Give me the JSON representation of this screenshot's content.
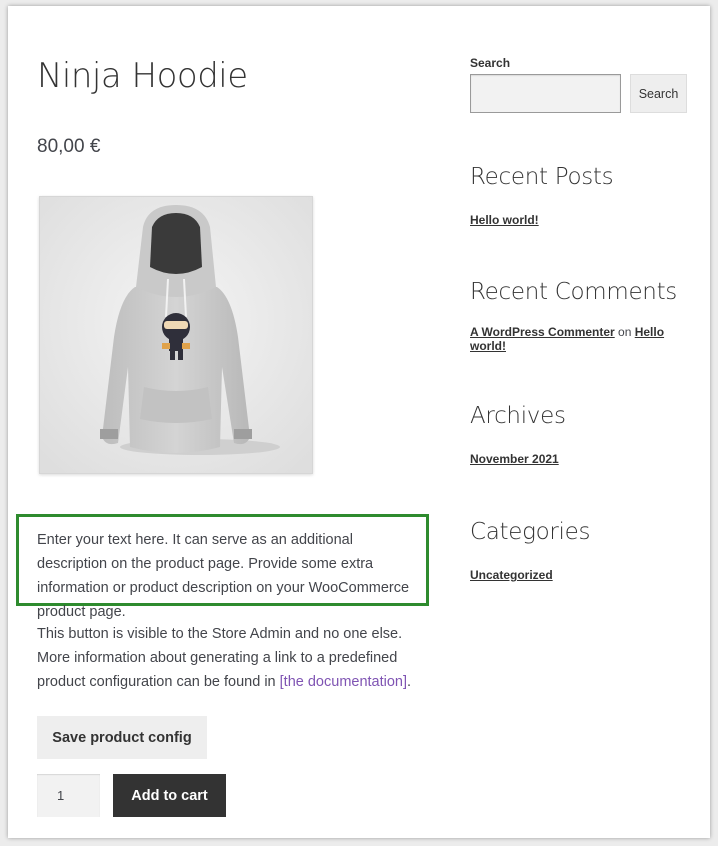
{
  "product": {
    "title": "Ninja Hoodie",
    "price": "80,00 €",
    "image_alt": "hoodie-product-image",
    "custom_text": "Enter your text here. It can serve as an additional description on the product page. Provide some extra information or product description on your WooCommerce product page.",
    "admin_note": {
      "before": "This button is visible to the Store Admin and no one else. More information about generating a link to a predefined product configuration can be found in ",
      "link": "[the documentation]",
      "after": "."
    },
    "save_config_label": "Save product config",
    "quantity": "1",
    "add_to_cart_label": "Add to cart"
  },
  "sidebar": {
    "search": {
      "label": "Search",
      "button_label": "Search",
      "value": ""
    },
    "recent_posts": {
      "title": "Recent Posts",
      "items": [
        "Hello world!"
      ]
    },
    "recent_comments": {
      "title": "Recent Comments",
      "author": "A WordPress Commenter",
      "connector": " on ",
      "post": "Hello world!"
    },
    "archives": {
      "title": "Archives",
      "items": [
        "November 2021"
      ]
    },
    "categories": {
      "title": "Categories",
      "items": [
        "Uncategorized"
      ]
    }
  },
  "colors": {
    "highlight_border": "#2e8b2e",
    "link": "#7f54b3",
    "button_dark": "#333333",
    "button_light": "#eeeeee"
  }
}
